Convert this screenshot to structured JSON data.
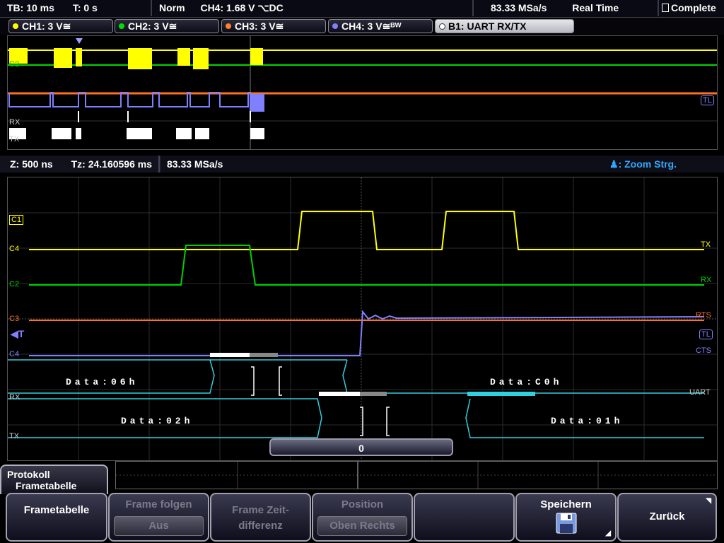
{
  "topbar": {
    "timebase": "TB: 10 ms",
    "trigger_time": "T: 0 s",
    "mode": "Norm",
    "trigger_source": "CH4: 1.68 V ⌥DC",
    "sample_rate": "83.33 MSa/s",
    "acq_mode": "Real Time",
    "status": "Complete"
  },
  "channels": [
    {
      "label": "CH1: 3 V≅",
      "color": "#ffff00"
    },
    {
      "label": "CH2: 3 V≅",
      "color": "#00e000"
    },
    {
      "label": "CH3: 3 V≅",
      "color": "#ff8030"
    },
    {
      "label": "CH4: 3 V≅ᴮᵂ",
      "color": "#8080ff"
    }
  ],
  "bus": {
    "label": "B1:  UART RX/TX"
  },
  "overview_tags": [
    "C2",
    "RX",
    "TX",
    "TL"
  ],
  "zoombar": {
    "zoom": "Z: 500 ns",
    "zoom_time": "Tz: 24.160596 ms",
    "sample_rate": "83.33 MSa/s",
    "zoom_ctrl": ": Zoom Strg."
  },
  "traces": {
    "left_tags": [
      "C1",
      "C4",
      "C2",
      "C3",
      "C4",
      "RX",
      "TX"
    ],
    "right_tags": [
      "TX",
      "RX",
      "RTS",
      "TL",
      "CTS",
      "UART"
    ],
    "trigger_marker": "◀T"
  },
  "decode": {
    "rx_frames": [
      "Data:06h",
      "Data:C0h"
    ],
    "tx_frames": [
      "Data:02h",
      "Data:01h"
    ]
  },
  "value_box": "0",
  "protocol_tab": {
    "line1": "Protokoll",
    "line2": "Frametabelle"
  },
  "softkeys": {
    "frametabelle": "Frametabelle",
    "frame_folgen": "Frame folgen",
    "frame_folgen_sub": "Aus",
    "frame_zeit_1": "Frame Zeit-",
    "frame_zeit_2": "differenz",
    "position": "Position",
    "position_sub": "Oben Rechts",
    "speichern": "Speichern",
    "zurueck": "Zurück"
  }
}
